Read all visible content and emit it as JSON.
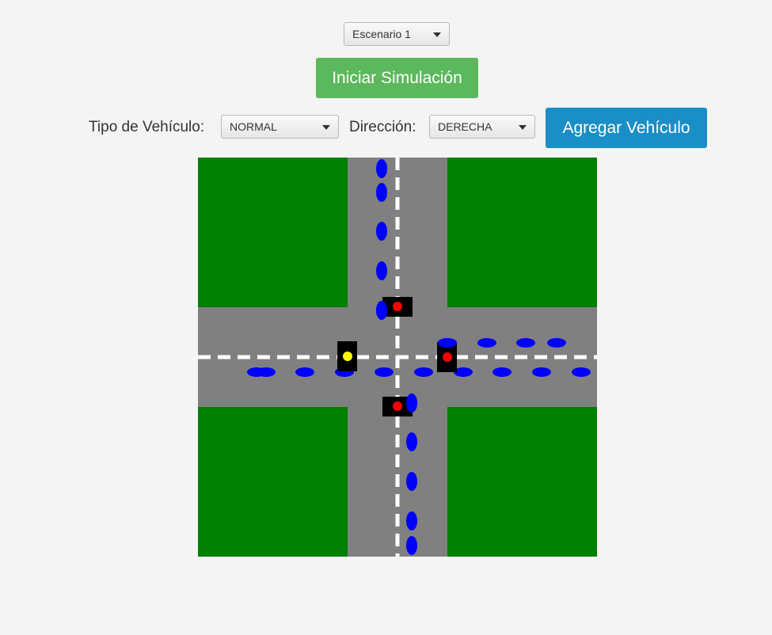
{
  "scenario_select": {
    "value": "Escenario 1"
  },
  "start_button": {
    "label": "Iniciar Simulación",
    "color": "#5cb85c"
  },
  "vehicle_type": {
    "label": "Tipo de Vehículo:",
    "value": "NORMAL"
  },
  "direction": {
    "label": "Dirección:",
    "value": "DERECHA"
  },
  "add_button": {
    "label": "Agregar Vehículo",
    "color": "#1a8ec7"
  },
  "intersection": {
    "colors": {
      "grass": "#008000",
      "road": "#808080",
      "lane_marking": "#ffffff",
      "vehicle": "#0000ff",
      "light_housing": "#000000",
      "red": "#ff0000",
      "yellow": "#ffff00"
    },
    "traffic_lights": [
      {
        "id": "north",
        "state": "red"
      },
      {
        "id": "west",
        "state": "yellow"
      },
      {
        "id": "east",
        "state": "red"
      },
      {
        "id": "south",
        "state": "red"
      }
    ]
  }
}
